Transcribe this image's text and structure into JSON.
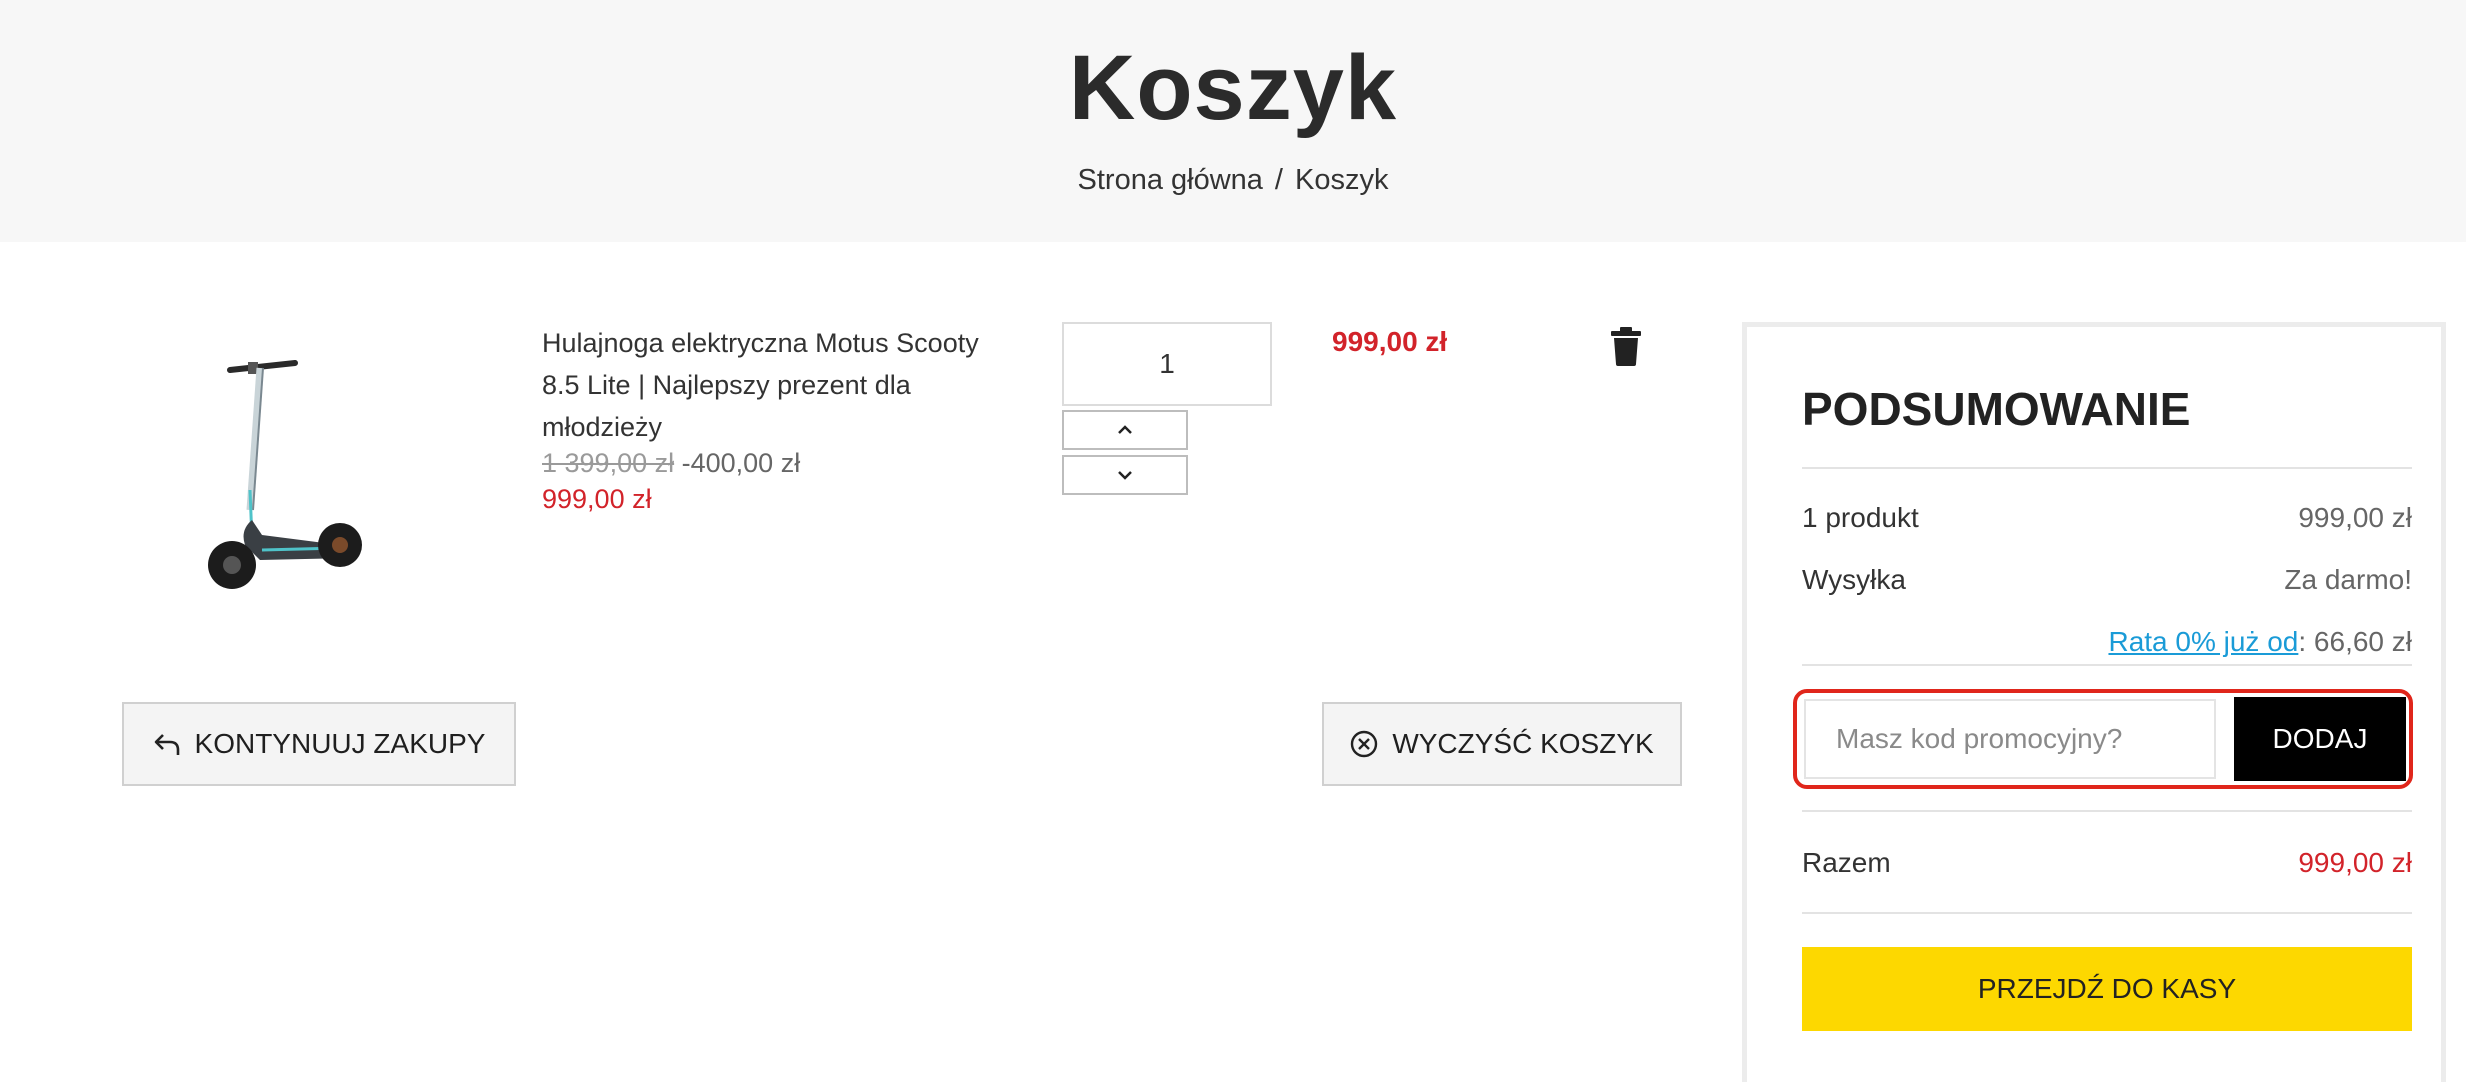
{
  "header": {
    "title": "Koszyk",
    "breadcrumb": {
      "home": "Strona główna",
      "separator": "/",
      "current": "Koszyk"
    }
  },
  "cart": {
    "item": {
      "name": "Hulajnoga elektryczna Motus Scooty 8.5 Lite | Najlepszy prezent dla młodzieży",
      "old_price": "1 399,00 zł",
      "discount": "-400,00 zł",
      "price": "999,00 zł",
      "quantity": "1",
      "line_total": "999,00 zł",
      "image_icon": "electric-scooter-image"
    },
    "continue_label": "KONTYNUUJ ZAKUPY",
    "clear_label": "WYCZYŚĆ KOSZYK"
  },
  "summary": {
    "title": "PODSUMOWANIE",
    "products_label": "1 produkt",
    "products_value": "999,00 zł",
    "shipping_label": "Wysyłka",
    "shipping_value": "Za darmo!",
    "installment_link": "Rata 0% już od",
    "installment_value": ": 66,60 zł",
    "promo_placeholder": "Masz kod promocyjny?",
    "promo_button": "DODAJ",
    "total_label": "Razem",
    "total_value": "999,00 zł",
    "checkout_label": "PRZEJDŹ DO KASY"
  },
  "colors": {
    "price_red": "#d2232a",
    "checkout_yellow": "#fdd800",
    "link_blue": "#1a9bd7",
    "highlight_red": "#e0261b"
  }
}
